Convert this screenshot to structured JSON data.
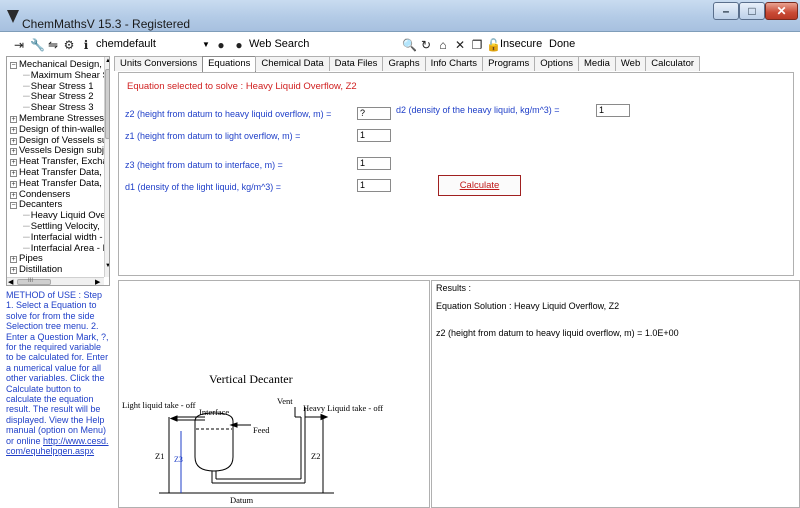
{
  "window": {
    "title": "ChemMathsV 15.3 - Registered",
    "min_glyph": "–",
    "max_glyph": "□",
    "close_glyph": "✕"
  },
  "toolbar": {
    "profile": "chemdefault",
    "web_search": "Web Search",
    "insecure": "Insecure",
    "done": "Done"
  },
  "tree": {
    "items": [
      {
        "label": "Mechanical Design, S",
        "level": 0,
        "expander": "−"
      },
      {
        "label": "Maximum Shear S",
        "level": 2,
        "expander": ""
      },
      {
        "label": "Shear Stress 1",
        "level": 2,
        "expander": ""
      },
      {
        "label": "Shear Stress 2",
        "level": 2,
        "expander": ""
      },
      {
        "label": "Shear Stress 3",
        "level": 2,
        "expander": ""
      },
      {
        "label": "Membrane Stresses",
        "level": 0,
        "expander": "+"
      },
      {
        "label": "Design of thin-walled",
        "level": 0,
        "expander": "+"
      },
      {
        "label": "Design of Vessels su",
        "level": 0,
        "expander": "+"
      },
      {
        "label": "Vessels Design subj",
        "level": 0,
        "expander": "+"
      },
      {
        "label": "Heat Transfer, Excha",
        "level": 0,
        "expander": "+"
      },
      {
        "label": "Heat Transfer Data, ",
        "level": 0,
        "expander": "+"
      },
      {
        "label": "Heat Transfer Data, L",
        "level": 0,
        "expander": "+"
      },
      {
        "label": "Condensers",
        "level": 0,
        "expander": "+"
      },
      {
        "label": "Decanters",
        "level": 0,
        "expander": "−"
      },
      {
        "label": "Heavy Liquid Ove",
        "level": 2,
        "expander": ""
      },
      {
        "label": "Settling Velocity,",
        "level": 2,
        "expander": ""
      },
      {
        "label": "Interfacial width - I",
        "level": 2,
        "expander": ""
      },
      {
        "label": "Interfacial Area - I",
        "level": 2,
        "expander": ""
      },
      {
        "label": "Pipes",
        "level": 0,
        "expander": "+"
      },
      {
        "label": "Distillation",
        "level": 0,
        "expander": "+"
      }
    ],
    "hscroll_glyph": "III"
  },
  "method": {
    "text": "METHOD of USE : Step 1. Select a Equation to solve for from the side Selection tree menu. 2. Enter a Question Mark, ?, for the required variable to be calculated for. Enter a numerical value for all other variables. Click the Calculate button to calculate the equation result. The result will be displayed. View the Help manual (option on Menu) or online ",
    "link": "http://www.cesd.com/equhelpgen.aspx"
  },
  "tabs": [
    {
      "label": "Units Conversions",
      "active": false
    },
    {
      "label": "Equations",
      "active": true
    },
    {
      "label": "Chemical Data",
      "active": false
    },
    {
      "label": "Data Files",
      "active": false
    },
    {
      "label": "Graphs",
      "active": false
    },
    {
      "label": "Info Charts",
      "active": false
    },
    {
      "label": "Programs",
      "active": false
    },
    {
      "label": "Options",
      "active": false
    },
    {
      "label": "Media",
      "active": false
    },
    {
      "label": "Web",
      "active": false
    },
    {
      "label": "Calculator",
      "active": false
    }
  ],
  "equation": {
    "title": "Equation selected to solve : Heavy Liquid Overflow, Z2",
    "z2_label": "z2 (height from datum to heavy liquid overflow, m) =",
    "z2_value": "?",
    "d2_label": "d2 (density of the heavy liquid, kg/m^3) =",
    "d2_value": "1",
    "z1_label": "z1 (height from datum to light overflow, m) =",
    "z1_value": "1",
    "z3_label": "z3 (height from datum to interface, m) =",
    "z3_value": "1",
    "d1_label": "d1 (density of the light liquid, kg/m^3) =",
    "d1_value": "1",
    "calculate": "Calculate"
  },
  "diagram": {
    "title": "Vertical Decanter",
    "light_takeoff": "Light liquid take - off",
    "vent": "Vent",
    "heavy_takeoff": "Heavy Liquid take - off",
    "interface": "Interface",
    "feed": "Feed",
    "z1": "Z1",
    "z3": "Z3",
    "z2": "Z2",
    "datum": "Datum"
  },
  "results": {
    "heading": "Results :",
    "solution": "Equation Solution : Heavy Liquid Overflow, Z2",
    "line": "z2 (height from datum to heavy liquid overflow, m) =  1.0E+00"
  }
}
